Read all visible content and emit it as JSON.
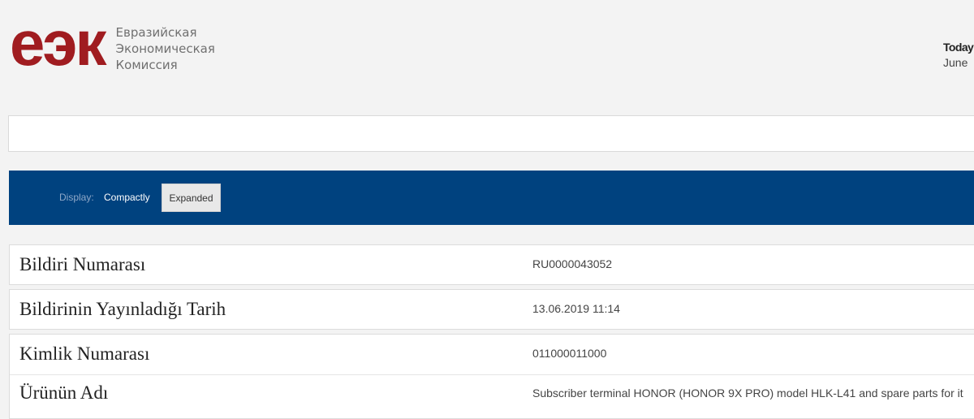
{
  "header": {
    "logo_mark": "ЕЭК",
    "logo_lines": [
      "Евразийская",
      "Экономическая",
      "Комиссия"
    ],
    "today_label": "Today",
    "today_date": "June"
  },
  "display": {
    "label": "Display:",
    "compact": "Compactly",
    "expanded": "Expanded"
  },
  "fields": [
    {
      "label": "Bildiri Numarası",
      "value": "RU0000043052"
    },
    {
      "label": "Bildirinin Yayınladığı Tarih",
      "value": "13.06.2019 11:14"
    },
    {
      "label": "Kimlik Numarası",
      "value": "011000011000"
    },
    {
      "label": "Ürünün Adı",
      "value": "Subscriber terminal HONOR (HONOR 9X PRO) model HLK-L41 and spare parts for it"
    }
  ],
  "colors": {
    "brand_red": "#a01c20",
    "bar_blue": "#00427f"
  }
}
